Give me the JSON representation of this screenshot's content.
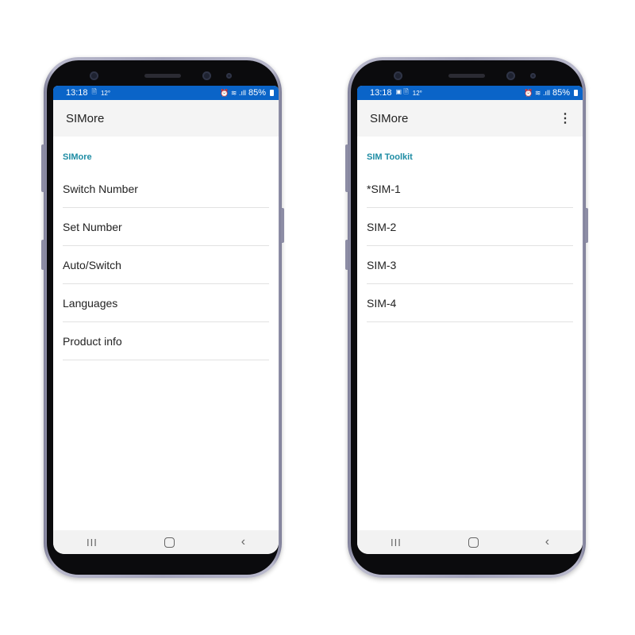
{
  "phones": [
    {
      "status": {
        "time": "13:18",
        "icons_left": "🗎",
        "temp": "12°",
        "signal": "⏰ ≋ .ıll",
        "battery": "85%"
      },
      "appbar": {
        "title": "SIMore",
        "menu": ""
      },
      "section": "SIMore",
      "items": [
        "Switch Number",
        "Set Number",
        "Auto/Switch",
        "Languages",
        "Product info"
      ],
      "nav": {
        "recent": "III",
        "back": "‹"
      }
    },
    {
      "status": {
        "time": "13:18",
        "icons_left": "▣ 🗎",
        "temp": "12°",
        "signal": "⏰ ≋ .ıll",
        "battery": "85%"
      },
      "appbar": {
        "title": "SIMore",
        "menu": "⋮"
      },
      "section": "SIM Toolkit",
      "items": [
        "*SIM-1",
        "SIM-2",
        "SIM-3",
        "SIM-4"
      ],
      "nav": {
        "recent": "III",
        "back": "‹"
      }
    }
  ],
  "colors": {
    "statusbar": "#0a64c8",
    "section": "#1e8ca4",
    "frame": "#a3a3bb"
  }
}
